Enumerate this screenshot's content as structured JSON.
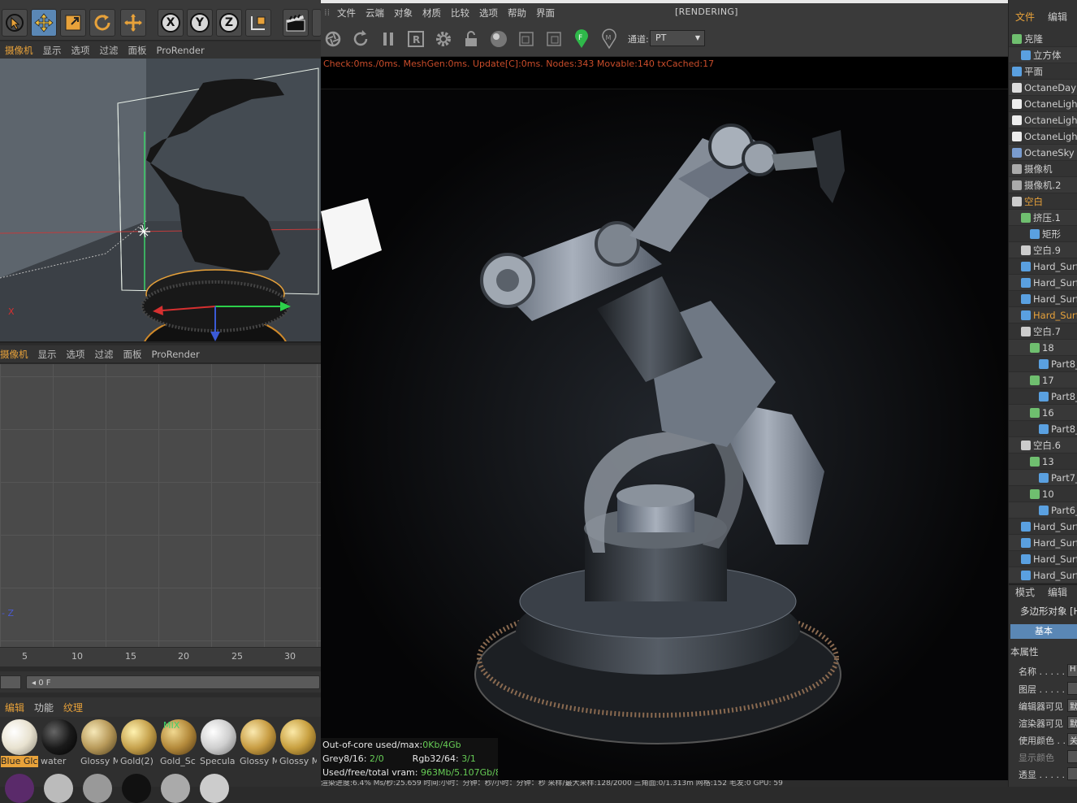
{
  "toolbar": {
    "axis_x": "X",
    "axis_y": "Y",
    "axis_z": "Z"
  },
  "viewport_menu": [
    "摄像机",
    "显示",
    "选项",
    "过滤",
    "面板",
    "ProRender"
  ],
  "viewport_axis": {
    "x_label": "X",
    "z_label": "Z"
  },
  "timeline": {
    "ticks": [
      "5",
      "10",
      "15",
      "20",
      "25",
      "30"
    ],
    "frame": "0 F"
  },
  "material_menu": [
    "编辑",
    "功能",
    "纹理"
  ],
  "materials": [
    {
      "name": "Blue Glc",
      "color": "#f2efe6"
    },
    {
      "name": "water",
      "color": "#1a1a1a"
    },
    {
      "name": "Glossy M",
      "color": "#b89a5a"
    },
    {
      "name": "Gold(2)",
      "color": "#c6a24d"
    },
    {
      "name": "Gold_Sc",
      "color": "#b48a3b"
    },
    {
      "name": "Specula",
      "color": "#d4d4d4"
    },
    {
      "name": "Glossy M",
      "color": "#c89d43"
    },
    {
      "name": "Glossy M",
      "color": "#c8a040"
    }
  ],
  "material_mix_label": "MIX",
  "octane": {
    "menu": [
      "文件",
      "云端",
      "对象",
      "材质",
      "比较",
      "选项",
      "帮助",
      "界面"
    ],
    "title": "[RENDERING]",
    "channel_label": "通道:",
    "channel_value": "PT",
    "stats_line": "Check:0ms./0ms. MeshGen:0ms. Update[C]:0ms. Nodes:343 Movable:140 txCached:17",
    "info": {
      "ooc_label": "Out-of-core used/max:",
      "ooc_value": "0Kb/4Gb",
      "grey_label": "Grey8/16: ",
      "grey_value": "2/0",
      "rgb_label": "Rgb32/64: ",
      "rgb_value": "3/1",
      "vram_label": "Used/free/total vram: ",
      "vram_value": "963Mb/5.107Gb/8Gb"
    },
    "status_line": "渲染进度:6.4%    Ms/秒:25.659    时间:小时：分钟：秒/小时：分钟：秒    采样/最大采样:128/2000    三角面:0/1.313m    网格:152    毛发:0    GPU:    59"
  },
  "object_manager": {
    "menu": [
      "文件",
      "编辑"
    ],
    "objects": [
      {
        "name": "克隆",
        "indent": 0,
        "icon": "#6fbf6f"
      },
      {
        "name": "立方体",
        "indent": 1,
        "icon": "#5aa0e0"
      },
      {
        "name": "平面",
        "indent": 0,
        "icon": "#5aa0e0"
      },
      {
        "name": "OctaneDayL",
        "indent": 0,
        "icon": "#dddddd"
      },
      {
        "name": "OctaneLight",
        "indent": 0,
        "icon": "#eeeeee"
      },
      {
        "name": "OctaneLight",
        "indent": 0,
        "icon": "#eeeeee"
      },
      {
        "name": "OctaneLight",
        "indent": 0,
        "icon": "#eeeeee"
      },
      {
        "name": "OctaneSky",
        "indent": 0,
        "icon": "#7a9ccf"
      },
      {
        "name": "摄像机",
        "indent": 0,
        "icon": "#aaaaaa"
      },
      {
        "name": "摄像机.2",
        "indent": 0,
        "icon": "#aaaaaa"
      },
      {
        "name": "空白",
        "indent": 0,
        "icon": "#cccccc",
        "highlight": true
      },
      {
        "name": "挤压.1",
        "indent": 1,
        "icon": "#6fbf6f"
      },
      {
        "name": "矩形",
        "indent": 2,
        "icon": "#5aa0e0"
      },
      {
        "name": "空白.9",
        "indent": 1,
        "icon": "#cccccc"
      },
      {
        "name": "Hard_Surf",
        "indent": 1,
        "icon": "#5aa0e0"
      },
      {
        "name": "Hard_Surf",
        "indent": 1,
        "icon": "#5aa0e0"
      },
      {
        "name": "Hard_Surf",
        "indent": 1,
        "icon": "#5aa0e0"
      },
      {
        "name": "Hard_Surf",
        "indent": 1,
        "icon": "#5aa0e0",
        "highlight": true
      },
      {
        "name": "空白.7",
        "indent": 1,
        "icon": "#cccccc"
      },
      {
        "name": "18",
        "indent": 2,
        "icon": "#6fbf6f"
      },
      {
        "name": "Part8_",
        "indent": 3,
        "icon": "#5aa0e0"
      },
      {
        "name": "17",
        "indent": 2,
        "icon": "#6fbf6f"
      },
      {
        "name": "Part8_",
        "indent": 3,
        "icon": "#5aa0e0"
      },
      {
        "name": "16",
        "indent": 2,
        "icon": "#6fbf6f"
      },
      {
        "name": "Part8_",
        "indent": 3,
        "icon": "#5aa0e0"
      },
      {
        "name": "空白.6",
        "indent": 1,
        "icon": "#cccccc"
      },
      {
        "name": "13",
        "indent": 2,
        "icon": "#6fbf6f"
      },
      {
        "name": "Part7_",
        "indent": 3,
        "icon": "#5aa0e0"
      },
      {
        "name": "10",
        "indent": 2,
        "icon": "#6fbf6f"
      },
      {
        "name": "Part6_",
        "indent": 3,
        "icon": "#5aa0e0"
      },
      {
        "name": "Hard_Surf",
        "indent": 1,
        "icon": "#5aa0e0"
      },
      {
        "name": "Hard_Surf",
        "indent": 1,
        "icon": "#5aa0e0"
      },
      {
        "name": "Hard_Surf",
        "indent": 1,
        "icon": "#5aa0e0"
      },
      {
        "name": "Hard_Surf",
        "indent": 1,
        "icon": "#5aa0e0"
      }
    ]
  },
  "attributes": {
    "menu": [
      "模式",
      "编辑"
    ],
    "object_label": "多边形对象 [H",
    "tab": "基本",
    "section": "本属性",
    "rows": [
      {
        "label": "名称 . . . . . .",
        "value": "H"
      },
      {
        "label": "图层 . . . . . .",
        "value": ""
      },
      {
        "label": "编辑器可见",
        "value": "默"
      },
      {
        "label": "渲染器可见",
        "value": "默"
      },
      {
        "label": "使用颜色 . .",
        "value": "关"
      },
      {
        "label": "显示颜色",
        "value": ""
      },
      {
        "label": "透显 . . . . . .",
        "value": ""
      }
    ]
  },
  "colors": {
    "accent": "#e8a23a",
    "selection": "#5a87b5",
    "stats_red": "#c94c2a",
    "info_green": "#66cc55"
  }
}
